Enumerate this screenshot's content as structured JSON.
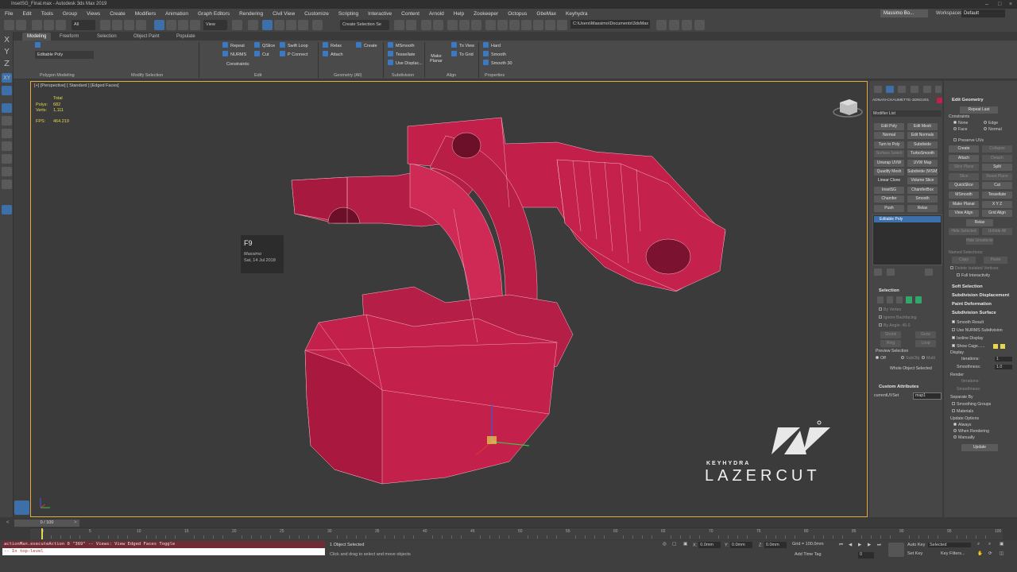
{
  "window": {
    "title": "InsetSG_Final.max - Autodesk 3ds Max 2019"
  },
  "menu": [
    "File",
    "Edit",
    "Tools",
    "Group",
    "Views",
    "Create",
    "Modifiers",
    "Animation",
    "Graph Editors",
    "Rendering",
    "Civil View",
    "Customize",
    "Scripting",
    "Interactive",
    "Content",
    "Arnold",
    "Help",
    "Zookeeper",
    "Octopus",
    "GbeMax",
    "Keyhydra"
  ],
  "user": {
    "name": "Massimo Bo...",
    "workspaces_label": "Workspaces:",
    "workspace": "Default"
  },
  "toolbar": {
    "filter": "All",
    "view": "View",
    "selection_set": "Create Selection Se",
    "project_path": "C:\\Users\\Massimo\\Documents\\3dsMax"
  },
  "ribbon_tabs": [
    "Modeling",
    "Freeform",
    "Selection",
    "Object Paint",
    "Populate"
  ],
  "ribbon": {
    "poly_group_label": "Polygon Modeling",
    "editable_poly": "Editable Poly",
    "modify_selection_label": "Modify Selection",
    "edit_label": "Edit",
    "geometry_label": "Geometry (All)",
    "subdivision_label": "Subdivision",
    "align_label": "Align",
    "properties_label": "Properties",
    "edit_items": [
      "Repeat",
      "QSlice",
      "Swift Loop",
      "NURMS",
      "Cut",
      "P Connect"
    ],
    "constraints": "Constraints:",
    "geo_items": [
      "Relax",
      "Create",
      "Attach"
    ],
    "subdiv_items": [
      "MSmooth",
      "Tessellate",
      "Use Displac..."
    ],
    "align_items": [
      "To View",
      "To Grid",
      "Make Planar"
    ],
    "prop_items": [
      "Hard",
      "Smooth",
      "Smooth 30"
    ]
  },
  "left_axes": [
    "X",
    "Y",
    "Z",
    "XY"
  ],
  "viewport": {
    "label": "[+] [Perspective] [ Standard ] [Edged Faces]",
    "stats": {
      "total": "Total",
      "polys_label": "Polys:",
      "polys": "682",
      "verts_label": "Verts:",
      "verts": "1,111",
      "fps_label": "FPS:",
      "fps": "464.219"
    },
    "tooltip": {
      "key": "F9",
      "user": "Massimo",
      "date": "Sat, 14 Jul 2018"
    },
    "logo": {
      "brand": "KEYHYDRA",
      "product": "LAZERCUT"
    }
  },
  "command_panel": {
    "object_name": "ADNAN-CHAUMETTE-3DNG301",
    "modifier_list": "Modifier List",
    "buttons": [
      [
        "Edit Poly",
        "Edit Mesh"
      ],
      [
        "Normal",
        "Edit Normals"
      ],
      [
        "Turn to Poly",
        "Subdivide"
      ],
      [
        "Surface Select",
        "TurboSmooth"
      ],
      [
        "Unwrap UVW",
        "UVW Map"
      ],
      [
        "Quadify Mesh",
        "Subdivide (WSM)"
      ],
      [
        "Linear Clone",
        "Volume Slice"
      ],
      [
        "InsetSG",
        "ChamferBox"
      ],
      [
        "Chamfer",
        "Smooth"
      ],
      [
        "Push",
        "Relax"
      ]
    ],
    "stack_item": "Editable Poly",
    "selection_header": "Selection",
    "selection_opts": [
      "By Vertex",
      "Ignore Backfacing",
      "By Angle: 45.0"
    ],
    "selection_btns": [
      "Shrink",
      "Grow",
      "Ring",
      "Loop"
    ],
    "preview_label": "Preview Selection",
    "preview_opts": [
      "Off",
      "SubObj",
      "Multi"
    ],
    "whole_object": "Whole Object Selected",
    "custom_attr_header": "Custom Attributes",
    "custom_attr_label": "currentUVSet",
    "custom_attr_value": "map1"
  },
  "edit_geometry": {
    "header": "Edit Geometry",
    "repeat_last": "Repeat Last",
    "constraints": "Constraints",
    "constraint_opts": [
      "None",
      "Edge",
      "Face",
      "Normal"
    ],
    "preserve_uvs": "Preserve UVs",
    "buttons": [
      [
        "Create",
        "Collapse"
      ],
      [
        "Attach",
        "Detach"
      ],
      [
        "Slice Plane",
        "Split"
      ],
      [
        "Slice",
        "Reset Plane"
      ],
      [
        "QuickSlice",
        "Cut"
      ],
      [
        "MSmooth",
        "Tessellate"
      ],
      [
        "Make Planar",
        "X Y Z"
      ],
      [
        "View Align",
        "Grid Align"
      ],
      [
        "Relax",
        ""
      ],
      [
        "Hide Selected",
        "Unhide All"
      ],
      [
        "Hide Unselected",
        ""
      ]
    ],
    "named_sel": "Named Selections:",
    "copy_paste": [
      "Copy",
      "Paste"
    ],
    "delete_iso": "Delete Isolated Vertices",
    "full_inter": "Full Interactivity",
    "soft_sel": "Soft Selection",
    "subdiv_disp": "Subdivision Displacement",
    "paint_def": "Paint Deformation",
    "subdiv_surf": "Subdivision Surface",
    "smooth_result": "Smooth Result",
    "use_nurms": "Use NURMS Subdivision",
    "isoline": "Isoline Display",
    "show_cage": "Show Cage......",
    "display": "Display",
    "iterations": "Iterations:",
    "iter_val": "1",
    "smoothness": "Smoothness:",
    "smooth_val": "1.0",
    "render": "Render",
    "separate_by": "Separate By",
    "smoothing_groups": "Smoothing Groups",
    "materials": "Materials",
    "update_opts": "Update Options",
    "update_radios": [
      "Always",
      "When Rendering",
      "Manually"
    ],
    "update_btn": "Update"
  },
  "timeline": {
    "frame": "0 / 100",
    "ticks": [
      "0",
      "5",
      "10",
      "15",
      "20",
      "25",
      "30",
      "35",
      "40",
      "45",
      "50",
      "55",
      "60",
      "65",
      "70",
      "75",
      "80",
      "85",
      "90",
      "95",
      "100"
    ]
  },
  "status": {
    "maxscript1": "actionMan.executeAction 0 \"369\"  -- Views: View Edged Faces Toggle",
    "maxscript2": "-- In top-level",
    "selected": "1 Object Selected",
    "hint": "Click and drag to select and move objects",
    "x_label": "X:",
    "x": "0.0mm",
    "y_label": "Y:",
    "y": "0.0mm",
    "z_label": "Z:",
    "z": "0.0mm",
    "grid": "Grid = 100.0mm",
    "add_time_tag": "Add Time Tag",
    "auto_key": "Auto Key",
    "selected_mode": "Selected",
    "set_key": "Set Key",
    "key_filters": "Key Filters...",
    "frame_field": "0"
  },
  "colors": {
    "model": "#c2204a",
    "accent": "#3d6fa8",
    "viewport_border": "#e5a93c"
  }
}
